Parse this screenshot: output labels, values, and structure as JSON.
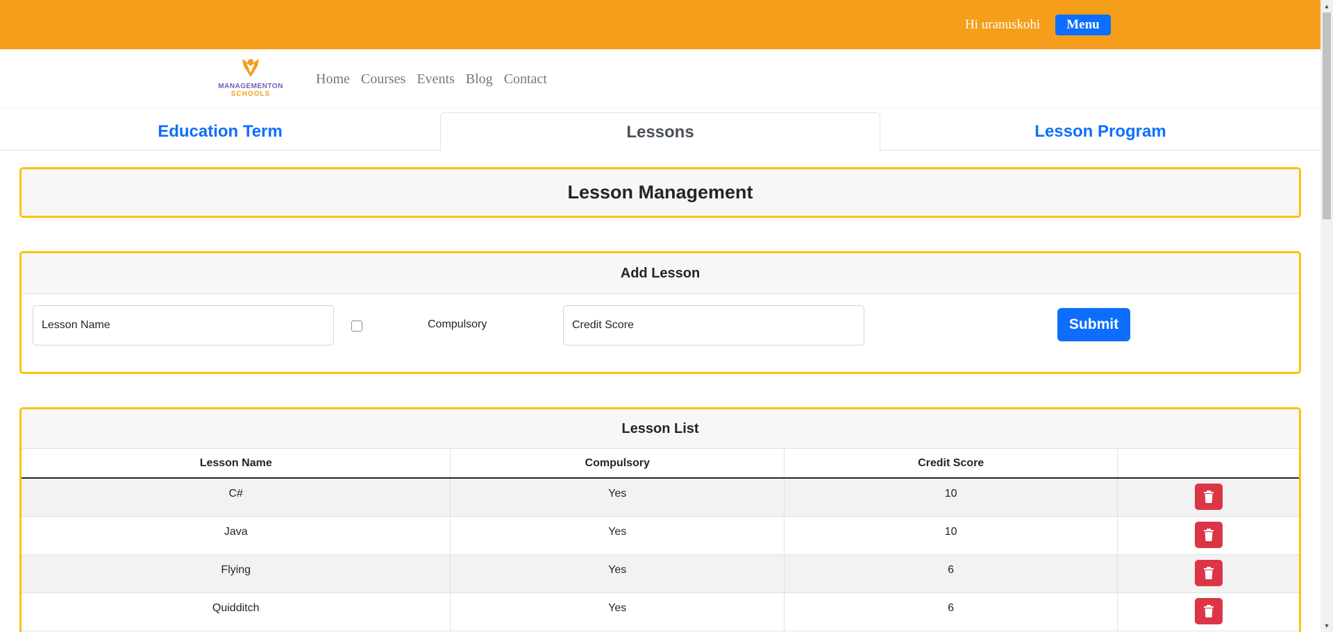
{
  "header": {
    "greeting": "Hi uranuskohi",
    "menu_label": "Menu"
  },
  "logo": {
    "line1": "MANAGEMENTON",
    "line2": "SCHOOLS"
  },
  "nav": {
    "items": [
      "Home",
      "Courses",
      "Events",
      "Blog",
      "Contact"
    ]
  },
  "tabs": [
    {
      "label": "Education Term",
      "active": false
    },
    {
      "label": "Lessons",
      "active": true
    },
    {
      "label": "Lesson Program",
      "active": false
    }
  ],
  "management": {
    "title": "Lesson Management"
  },
  "add_lesson": {
    "title": "Add Lesson",
    "name_placeholder": "Lesson Name",
    "compulsory_label": "Compulsory",
    "credit_placeholder": "Credit Score",
    "submit_label": "Submit"
  },
  "lesson_list": {
    "title": "Lesson List",
    "headers": [
      "Lesson Name",
      "Compulsory",
      "Credit Score",
      ""
    ],
    "rows": [
      {
        "name": "C#",
        "compulsory": "Yes",
        "credit": "10"
      },
      {
        "name": "Java",
        "compulsory": "Yes",
        "credit": "10"
      },
      {
        "name": "Flying",
        "compulsory": "Yes",
        "credit": "6"
      },
      {
        "name": "Quidditch",
        "compulsory": "Yes",
        "credit": "6"
      }
    ]
  },
  "colors": {
    "topbar": "#f49e1b",
    "primary": "#0d6efd",
    "danger": "#dc3545",
    "panel_border": "#ffc107"
  }
}
